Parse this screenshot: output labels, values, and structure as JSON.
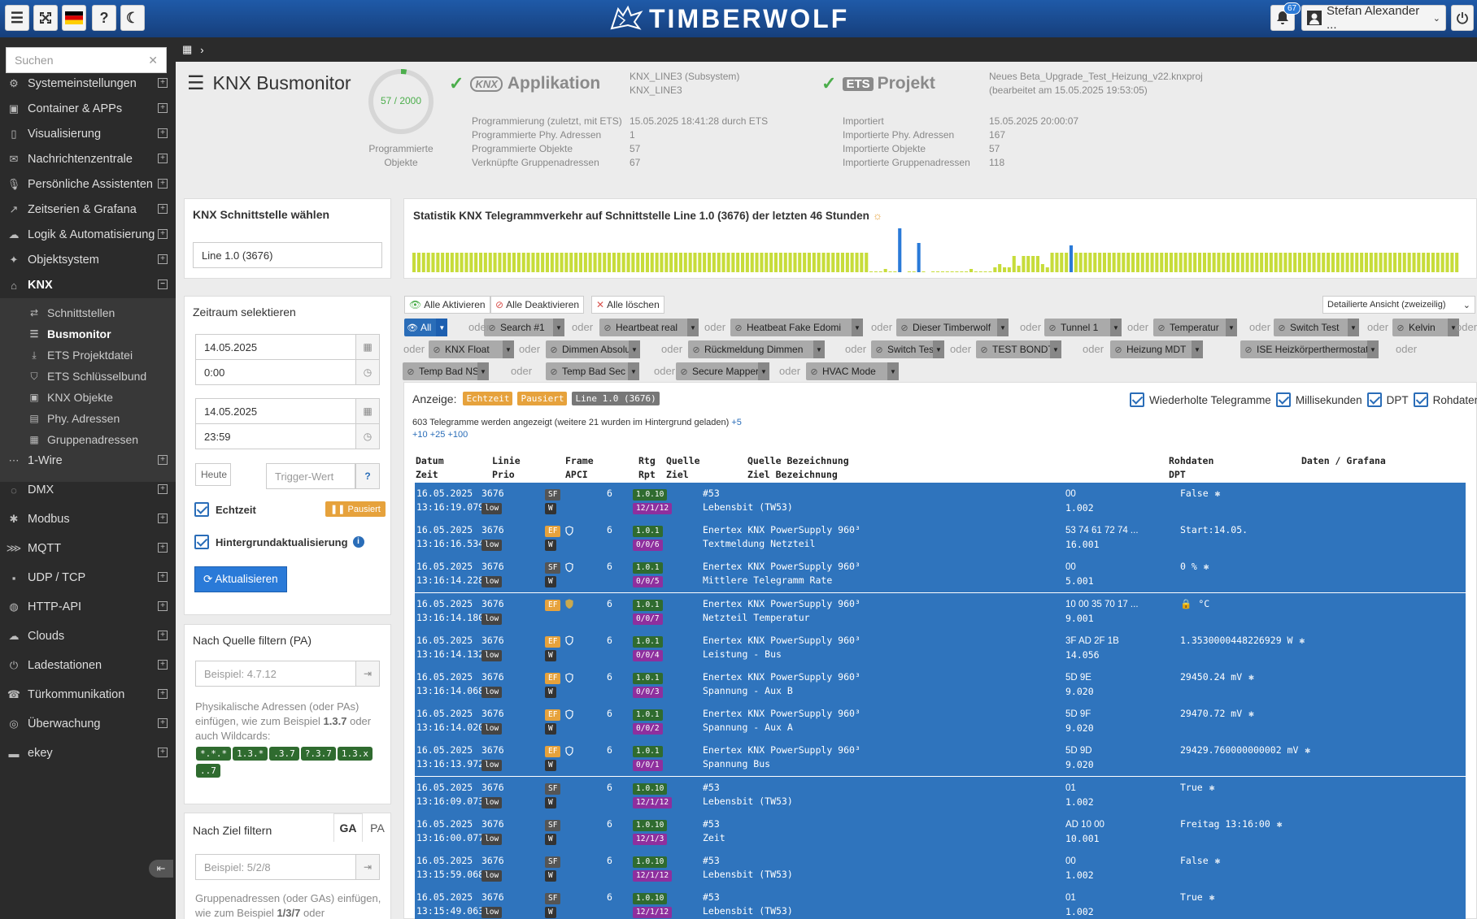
{
  "topbar": {
    "logo_text": "TIMBERWOLF",
    "notification_count": "67",
    "user_name": "Stefan Alexander ..."
  },
  "sidebar": {
    "search_placeholder": "Suchen",
    "items": [
      {
        "label": "Systemeinstellungen",
        "icon": "sliders-icon"
      },
      {
        "label": "Container & APPs",
        "icon": "cubes-icon"
      },
      {
        "label": "Visualisierung",
        "icon": "mobile-icon"
      },
      {
        "label": "Nachrichtenzentrale",
        "icon": "envelope-icon"
      },
      {
        "label": "Persönliche Assistenten",
        "icon": "microphone-icon"
      },
      {
        "label": "Zeitserien & Grafana",
        "icon": "line-chart-icon"
      },
      {
        "label": "Logik & Automatisierung",
        "icon": "brain-icon"
      },
      {
        "label": "Objektsystem",
        "icon": "satellite-icon"
      },
      {
        "label": "KNX",
        "icon": "knx-icon"
      }
    ],
    "knx_sub": [
      {
        "label": "Schnittstellen",
        "icon": "exchange-icon"
      },
      {
        "label": "Busmonitor",
        "icon": "list-icon"
      },
      {
        "label": "ETS Projektdatei",
        "icon": "download-icon"
      },
      {
        "label": "ETS Schlüsselbund",
        "icon": "shield-icon"
      },
      {
        "label": "KNX Objekte",
        "icon": "cubes-icon"
      },
      {
        "label": "Phy. Adressen",
        "icon": "address-icon"
      },
      {
        "label": "Gruppenadressen",
        "icon": "grid-icon"
      }
    ],
    "items2": [
      {
        "label": "1-Wire",
        "icon": "onewire-icon"
      },
      {
        "label": "DMX",
        "icon": "bulb-icon"
      },
      {
        "label": "Modbus",
        "icon": "cog-icon"
      },
      {
        "label": "MQTT",
        "icon": "mqtt-icon"
      },
      {
        "label": "UDP / TCP",
        "icon": "ip-icon"
      },
      {
        "label": "HTTP-API",
        "icon": "globe-icon"
      },
      {
        "label": "Clouds",
        "icon": "cloud-icon"
      },
      {
        "label": "Ladestationen",
        "icon": "plug-icon"
      },
      {
        "label": "Türkommunikation",
        "icon": "intercom-icon"
      },
      {
        "label": "Überwachung",
        "icon": "cctv-icon"
      },
      {
        "label": "ekey",
        "icon": "ekey-icon"
      }
    ]
  },
  "header": {
    "title": "KNX Busmonitor",
    "donut_text": "57 / 2000",
    "donut_fraction": 0.0285,
    "donut_caption_1": "Programmierte",
    "donut_caption_2": "Objekte",
    "app_title": "Applikation",
    "app_logo": "KNX",
    "app_sub1": "KNX_LINE3 (Subsystem)",
    "app_sub2": "KNX_LINE3",
    "app_rows": [
      {
        "label": "Programmierung (zuletzt, mit ETS)",
        "value": "15.05.2025 18:41:28 durch ETS"
      },
      {
        "label": "Programmierte Phy. Adressen",
        "value": "1"
      },
      {
        "label": "Programmierte Objekte",
        "value": "57"
      },
      {
        "label": "Verknüpfte Gruppenadressen",
        "value": "67"
      }
    ],
    "ets_logo": "ETS",
    "ets_title": "Projekt",
    "ets_sub1": "Neues Beta_Upgrade_Test_Heizung_v22.knxproj",
    "ets_sub2": "(bearbeitet am 15.05.2025 19:53:05)",
    "ets_rows": [
      {
        "label": "Importiert",
        "value": "15.05.2025 20:00:07"
      },
      {
        "label": "Importierte Phy. Adressen",
        "value": "167"
      },
      {
        "label": "Importierte Objekte",
        "value": "57"
      },
      {
        "label": "Importierte Gruppenadressen",
        "value": "118"
      }
    ]
  },
  "interface_panel": {
    "title": "KNX Schnittstelle wählen",
    "value": "Line 1.0 (3676)"
  },
  "time_panel": {
    "title": "Zeitraum selektieren",
    "from_date": "14.05.2025",
    "from_time": "0:00",
    "to_date": "14.05.2025",
    "to_time": "23:59",
    "today": "Heute",
    "trigger_placeholder": "Trigger-Wert",
    "echtzeit": "Echtzeit",
    "paused": "Pausiert",
    "background": "Hintergrundaktualisierung",
    "refresh": "Aktualisieren"
  },
  "source_panel": {
    "title": "Nach Quelle filtern (PA)",
    "placeholder": "Beispiel: 4.7.12",
    "help": "Physikalische Adressen (oder PAs) einfügen, wie zum Beispiel",
    "help_example": "1.3.7",
    "help_or": "oder auch Wildcards:",
    "wildcards": [
      "*.*.*",
      "1.3.*",
      ".3.7",
      "?.3.7",
      "1.3.x",
      "..7"
    ]
  },
  "target_panel": {
    "title": "Nach Ziel filtern",
    "tab_ga": "GA",
    "tab_pa": "PA",
    "placeholder": "Beispiel: 5/2/8",
    "help": "Gruppenadressen (oder GAs) einfügen, wie zum Beispiel",
    "help_example": "1/3/7",
    "help_or": "oder"
  },
  "stats": {
    "title": "Statistik KNX Telegrammverkehr auf Schnittstelle Line 1.0 (3676) der letzten 46 Stunden",
    "bar_color": "#c7dc3a",
    "spike_color": "#2a7ad8"
  },
  "filters": {
    "activate_all": "Alle Aktivieren",
    "deactivate_all": "Alle Deaktivieren",
    "delete_all": "Alle löschen",
    "view_select": "Detailierte Ansicht (zweizeilig)",
    "all_label": "All",
    "or": "oder",
    "tags": [
      "Search #1",
      "Heartbeat real",
      "Heatbeat Fake Edomi",
      "Dieser Timberwolf",
      "Tunnel 1",
      "Temperatur",
      "Switch Test",
      "Kelvin",
      "KNX Float",
      "Dimmen Absolut",
      "Rückmeldung Dimmen",
      "Switch Test",
      "TEST BONDT",
      "Heizung MDT",
      "ISE Heizkörperthermostat",
      "Temp Bad NS",
      "Temp Bad Sec",
      "Secure Mapper",
      "HVAC Mode"
    ]
  },
  "display": {
    "label": "Anzeige:",
    "badge_live": "Echtzeit",
    "badge_paused": "Pausiert",
    "badge_line": "Line 1.0 (3676)",
    "opt_repeat": "Wiederholte Telegramme",
    "opt_ms": "Millisekunden",
    "opt_dpt": "DPT",
    "opt_raw": "Rohdaten",
    "count_text": "603 Telegramme werden angezeigt (weitere 21 wurden im Hintergrund geladen)",
    "more_links": [
      "+5",
      "+10",
      "+25",
      "+100"
    ]
  },
  "table": {
    "headers": {
      "c1a": "Datum",
      "c1b": "Zeit",
      "c2a": "Linie",
      "c2b": "Prio",
      "c3a": "Frame",
      "c3b": "APCI",
      "c4a": "Rtg",
      "c4b": "Rpt",
      "c5a": "Quelle",
      "c5b": "Ziel",
      "c6a": "Quelle Bezeichnung",
      "c6b": "Ziel Bezeichnung",
      "c7a": "Rohdaten",
      "c7b": "DPT",
      "c8a": "Daten / Grafana"
    },
    "rows": [
      {
        "date": "16.05.2025",
        "time": "13:16:19.079",
        "line": "3676",
        "prio": "low",
        "frame": "SF",
        "apci": "W",
        "secure": false,
        "rtg": "6",
        "src": "1.0.10",
        "dst": "12/1/12",
        "src_name": "#53",
        "dst_name": "Lebensbit (TW53)",
        "raw": "00",
        "dpt": "1.002",
        "data": "False",
        "data_icon": "cog-icon"
      },
      {
        "date": "16.05.2025",
        "time": "13:16:16.534",
        "line": "3676",
        "prio": "low",
        "frame": "EF",
        "apci": "W",
        "secure": true,
        "rtg": "6",
        "src": "1.0.1",
        "dst": "0/0/6",
        "src_name": "Enertex KNX PowerSupply 960³",
        "dst_name": "Textmeldung Netzteil",
        "raw": "53 74 61 72 74 ...",
        "dpt": "16.001",
        "data": "Start:14.05.",
        "data_icon": ""
      },
      {
        "date": "16.05.2025",
        "time": "13:16:14.228",
        "line": "3676",
        "prio": "low",
        "frame": "SF",
        "apci": "W",
        "secure": true,
        "rtg": "6",
        "src": "1.0.1",
        "dst": "0/0/5",
        "src_name": "Enertex KNX PowerSupply 960³",
        "dst_name": "Mittlere Telegramm Rate",
        "raw": "00",
        "dpt": "5.001",
        "data": "0 %",
        "data_icon": "cog-icon"
      },
      {
        "date": "16.05.2025",
        "time": "13:16:14.180",
        "line": "3676",
        "prio": "low",
        "frame": "EF",
        "apci": "",
        "secure": true,
        "secure_gold": true,
        "rtg": "6",
        "src": "1.0.1",
        "dst": "0/0/7",
        "src_name": "Enertex KNX PowerSupply 960³",
        "dst_name": "Netzteil Temperatur",
        "raw": "10 00 35 70 17 ...",
        "dpt": "9.001",
        "data": "°C",
        "data_icon": "lock-icon"
      },
      {
        "date": "16.05.2025",
        "time": "13:16:14.132",
        "line": "3676",
        "prio": "low",
        "frame": "EF",
        "apci": "W",
        "secure": true,
        "rtg": "6",
        "src": "1.0.1",
        "dst": "0/0/4",
        "src_name": "Enertex KNX PowerSupply 960³",
        "dst_name": "Leistung - Bus",
        "raw": "3F AD 2F 1B",
        "dpt": "14.056",
        "data": "1.3530000448226929 W",
        "data_icon": "cog-icon"
      },
      {
        "date": "16.05.2025",
        "time": "13:16:14.068",
        "line": "3676",
        "prio": "low",
        "frame": "EF",
        "apci": "W",
        "secure": true,
        "rtg": "6",
        "src": "1.0.1",
        "dst": "0/0/3",
        "src_name": "Enertex KNX PowerSupply 960³",
        "dst_name": "Spannung - Aux B",
        "raw": "5D 9E",
        "dpt": "9.020",
        "data": "29450.24 mV",
        "data_icon": "cog-icon"
      },
      {
        "date": "16.05.2025",
        "time": "13:16:14.020",
        "line": "3676",
        "prio": "low",
        "frame": "EF",
        "apci": "W",
        "secure": true,
        "rtg": "6",
        "src": "1.0.1",
        "dst": "0/0/2",
        "src_name": "Enertex KNX PowerSupply 960³",
        "dst_name": "Spannung - Aux A",
        "raw": "5D 9F",
        "dpt": "9.020",
        "data": "29470.72 mV",
        "data_icon": "cog-icon"
      },
      {
        "date": "16.05.2025",
        "time": "13:16:13.972",
        "line": "3676",
        "prio": "low",
        "frame": "EF",
        "apci": "W",
        "secure": true,
        "rtg": "6",
        "src": "1.0.1",
        "dst": "0/0/1",
        "src_name": "Enertex KNX PowerSupply 960³",
        "dst_name": "Spannung Bus",
        "raw": "5D 9D",
        "dpt": "9.020",
        "data": "29429.760000000002 mV",
        "data_icon": "cog-icon"
      },
      {
        "date": "16.05.2025",
        "time": "13:16:09.073",
        "line": "3676",
        "prio": "low",
        "frame": "SF",
        "apci": "W",
        "secure": false,
        "rtg": "6",
        "src": "1.0.10",
        "dst": "12/1/12",
        "src_name": "#53",
        "dst_name": "Lebensbit (TW53)",
        "raw": "01",
        "dpt": "1.002",
        "data": "True",
        "data_icon": "cog-icon"
      },
      {
        "date": "16.05.2025",
        "time": "13:16:00.077",
        "line": "3676",
        "prio": "low",
        "frame": "SF",
        "apci": "W",
        "secure": false,
        "rtg": "6",
        "src": "1.0.10",
        "dst": "12/1/3",
        "src_name": "#53",
        "dst_name": "Zeit",
        "raw": "AD 10 00",
        "dpt": "10.001",
        "data": "Freitag 13:16:00",
        "data_icon": "cog-icon"
      },
      {
        "date": "16.05.2025",
        "time": "13:15:59.068",
        "line": "3676",
        "prio": "low",
        "frame": "SF",
        "apci": "W",
        "secure": false,
        "rtg": "6",
        "src": "1.0.10",
        "dst": "12/1/12",
        "src_name": "#53",
        "dst_name": "Lebensbit (TW53)",
        "raw": "00",
        "dpt": "1.002",
        "data": "False",
        "data_icon": "cog-icon"
      },
      {
        "date": "16.05.2025",
        "time": "13:15:49.063",
        "line": "3676",
        "prio": "low",
        "frame": "SF",
        "apci": "W",
        "secure": false,
        "rtg": "6",
        "src": "1.0.10",
        "dst": "12/1/12",
        "src_name": "#53",
        "dst_name": "Lebensbit (TW53)",
        "raw": "01",
        "dpt": "1.002",
        "data": "True",
        "data_icon": "cog-icon"
      }
    ]
  }
}
